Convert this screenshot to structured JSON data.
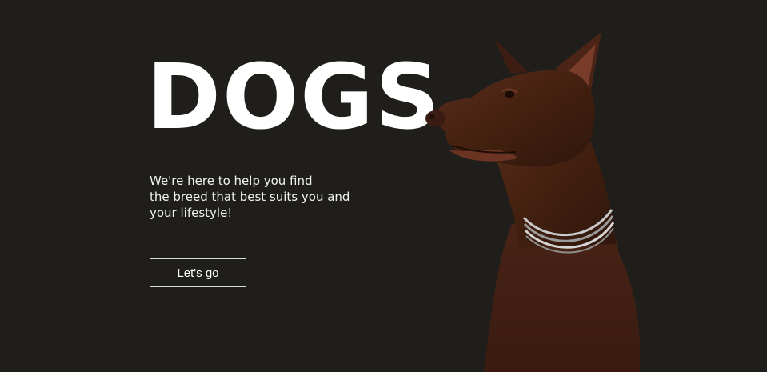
{
  "hero": {
    "title": "DOGS",
    "subtitle_lines": [
      "We're here to help you find",
      "the breed that best suits you and",
      "your lifestyle!"
    ],
    "cta_label": "Let's go"
  },
  "colors": {
    "background": "#1f1e1a",
    "title": "#ffffff",
    "text": "#f2f2f2",
    "button_border": "#d9d9d6",
    "dog_coat": "#4a2418"
  },
  "image": {
    "semantic": "doberman-dog-photo"
  }
}
